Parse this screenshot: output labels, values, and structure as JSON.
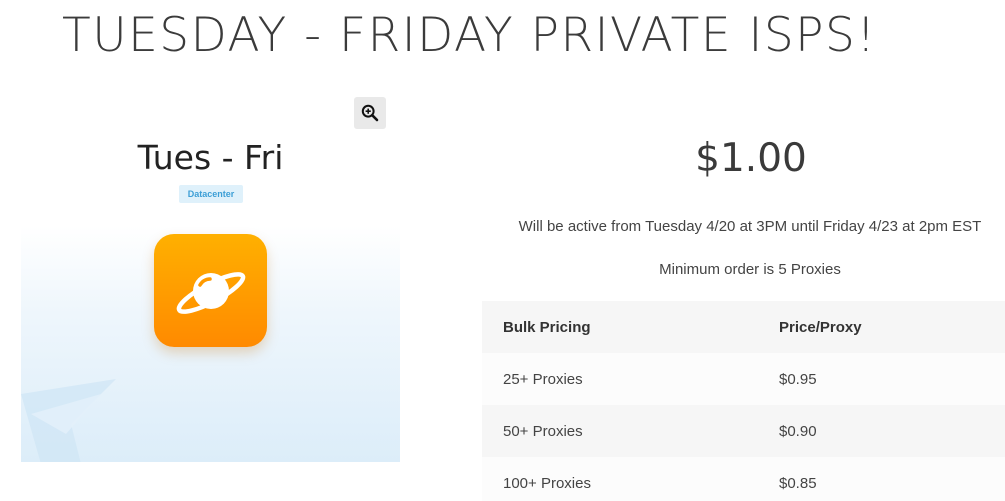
{
  "page": {
    "title": "TUESDAY - FRIDAY PRIVATE ISPS!"
  },
  "product": {
    "name": "Tues - Fri",
    "badge": "Datacenter",
    "zoom_icon": "zoom-in-icon",
    "app_icon": "planet-icon",
    "colors": {
      "icon_top": "#ffb000",
      "icon_bottom": "#ff8a00",
      "badge_bg": "#dff1fb",
      "badge_text": "#3d9fd6"
    }
  },
  "pricing": {
    "price": "$1.00",
    "active_note": "Will be active from Tuesday 4/20 at 3PM until Friday 4/23 at 2pm EST",
    "min_order": "Minimum order is 5 Proxies"
  },
  "bulk_table": {
    "headers": [
      "Bulk Pricing",
      "Price/Proxy"
    ],
    "rows": [
      [
        "25+ Proxies",
        "$0.95"
      ],
      [
        "50+ Proxies",
        "$0.90"
      ],
      [
        "100+ Proxies",
        "$0.85"
      ]
    ]
  }
}
